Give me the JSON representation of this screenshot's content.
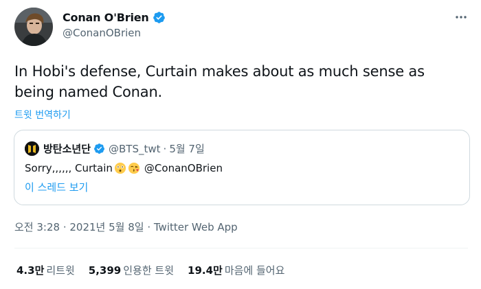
{
  "author": {
    "display_name": "Conan O'Brien",
    "handle": "@ConanOBrien",
    "avatar_icon": "avatar-photo",
    "verified_icon": "verified-badge-icon"
  },
  "tweet": {
    "text": "In Hobi's defense, Curtain makes about as much sense as being named Conan.",
    "translate_label": "트윗 번역하기"
  },
  "quote": {
    "display_name": "방탄소년단",
    "handle": "@BTS_twt",
    "separator": "·",
    "date": "5월 7일",
    "body_text": "Sorry,,,,,, Curtain",
    "emojis": [
      "flushed-face-emoji",
      "kiss-face-emoji"
    ],
    "mention": "@ConanOBrien",
    "show_thread": "이 스레드 보기"
  },
  "meta": {
    "time": "오전 3:28 · 2021년 5월 8일 ·",
    "app": "Twitter Web App"
  },
  "stats": [
    {
      "count": "4.3만",
      "label": "리트윗"
    },
    {
      "count": "5,399",
      "label": "인용한 트윗"
    },
    {
      "count": "19.4만",
      "label": "마음에 들어요"
    }
  ],
  "colors": {
    "accent": "#1d9bf0",
    "text_primary": "#0f1419",
    "text_secondary": "#536471",
    "border": "#cfd9de"
  }
}
